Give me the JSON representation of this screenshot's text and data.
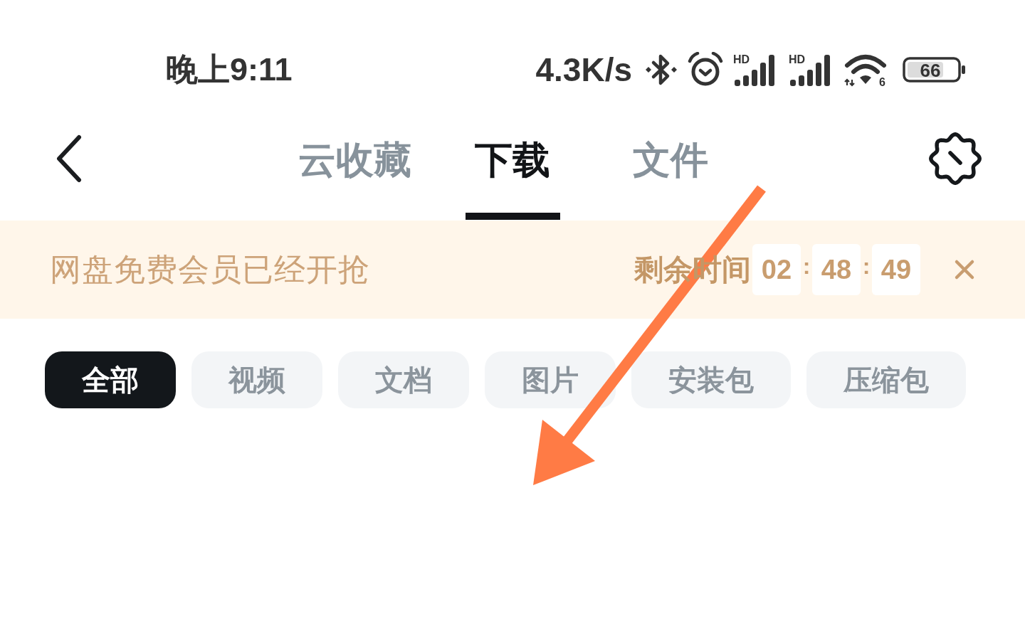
{
  "status_bar": {
    "time": "晚上9:11",
    "net_speed": "4.3K/s",
    "signals": [
      {
        "label": "HD"
      },
      {
        "label": "HD"
      }
    ],
    "wifi": {
      "label": "6"
    },
    "battery": "66"
  },
  "header": {
    "tabs": [
      {
        "label": "云收藏",
        "selected": false
      },
      {
        "label": "下载",
        "selected": true
      },
      {
        "label": "文件",
        "selected": false
      }
    ]
  },
  "banner": {
    "text": "网盘免费会员已经开抢",
    "countdown_label": "剩余时间",
    "countdown": {
      "hours": "02",
      "minutes": "48",
      "seconds": "49",
      "separators": [
        ":",
        ":"
      ]
    }
  },
  "filters": [
    {
      "label": "全部",
      "selected": true
    },
    {
      "label": "视频",
      "selected": false
    },
    {
      "label": "文档",
      "selected": false
    },
    {
      "label": "图片",
      "selected": false
    },
    {
      "label": "安装包",
      "selected": false
    },
    {
      "label": "压缩包",
      "selected": false
    }
  ]
}
